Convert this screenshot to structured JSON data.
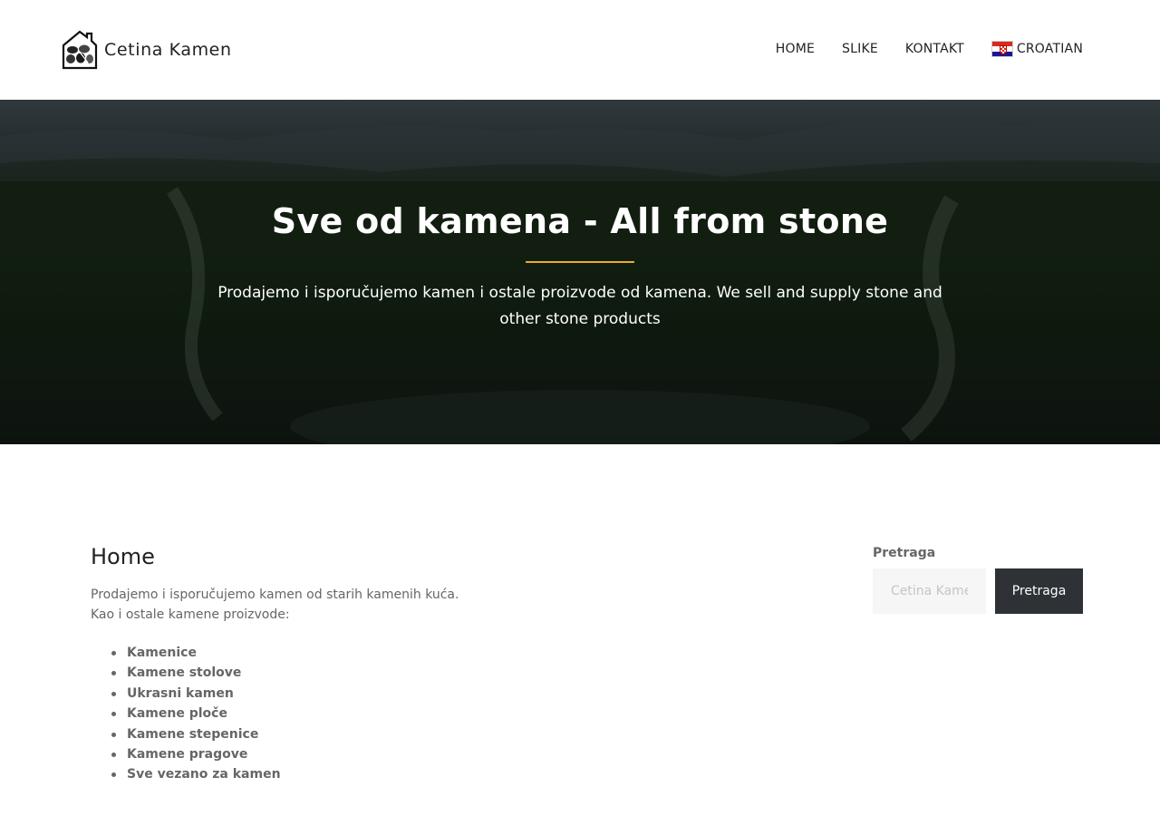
{
  "header": {
    "logo_text": "Cetina Kamen",
    "logo_icon": "stone-house-icon",
    "nav": [
      {
        "label": "HOME"
      },
      {
        "label": "SLIKE"
      },
      {
        "label": "KONTAKT"
      }
    ],
    "language": {
      "label": "CROATIAN",
      "flag_icon": "croatia-flag-icon"
    }
  },
  "hero": {
    "title": "Sve od kamena - All from stone",
    "subtitle": "Prodajemo i isporučujemo kamen i ostale proizvode od kamena. We sell and supply stone and other stone products",
    "accent_color": "#f0a830"
  },
  "main": {
    "title": "Home",
    "intro_line1": "Prodajemo i isporučujemo kamen od starih kamenih kuća.",
    "intro_line2": "Kao i ostale kamene proizvode:",
    "products": [
      "Kamenice",
      "Kamene stolove",
      "Ukrasni kamen",
      "Kamene ploče",
      "Kamene stepenice",
      "Kamene pragove",
      "Sve vezano za kamen"
    ]
  },
  "sidebar": {
    "search_label": "Pretraga",
    "search_placeholder": "Cetina Kame",
    "search_button": "Pretraga",
    "button_color": "#2e3136"
  }
}
